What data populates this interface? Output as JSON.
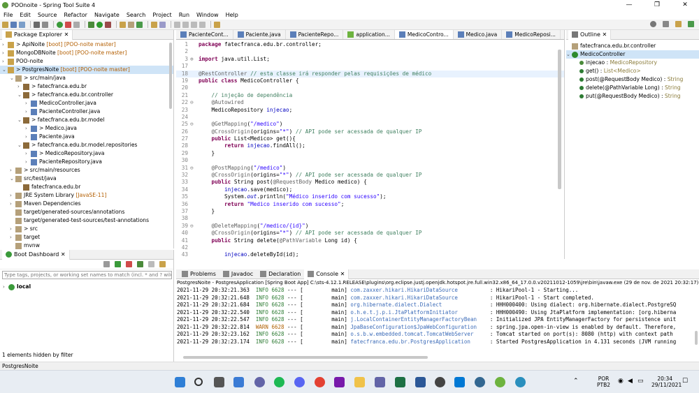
{
  "window": {
    "title": "POOnoite - Spring Tool Suite 4",
    "min": "—",
    "max": "❐",
    "close": "✕"
  },
  "menu": [
    "File",
    "Edit",
    "Source",
    "Refactor",
    "Navigate",
    "Search",
    "Project",
    "Run",
    "Window",
    "Help"
  ],
  "package_explorer": {
    "title": "Package Explorer",
    "close": "✕",
    "items": [
      {
        "text": "ApiNoite",
        "dec": " [boot] [POO-noite master]",
        "indent": 0,
        "arrow": "›",
        "pre": "> "
      },
      {
        "text": "MongoDBNoite",
        "dec": " [boot] [POO-noite master]",
        "indent": 0,
        "arrow": "›",
        "pre": ""
      },
      {
        "text": "POO-noite",
        "dec": "",
        "indent": 0,
        "arrow": "›",
        "pre": ""
      },
      {
        "text": "PostgresNoite",
        "dec": " [boot] [POO-noite master]",
        "indent": 0,
        "arrow": "⌄",
        "pre": "> ",
        "sel": true
      },
      {
        "text": "src/main/java",
        "dec": "",
        "indent": 1,
        "arrow": "⌄",
        "pre": "> "
      },
      {
        "text": "fatecfranca.edu.br",
        "dec": "",
        "indent": 2,
        "arrow": "›",
        "pre": "> "
      },
      {
        "text": "fatecfranca.edu.br.controller",
        "dec": "",
        "indent": 2,
        "arrow": "⌄",
        "pre": "> "
      },
      {
        "text": "MedicoController.java",
        "dec": "",
        "indent": 3,
        "arrow": "›",
        "pre": ""
      },
      {
        "text": "PacienteController.java",
        "dec": "",
        "indent": 3,
        "arrow": "›",
        "pre": ""
      },
      {
        "text": "fatecfranca.edu.br.model",
        "dec": "",
        "indent": 2,
        "arrow": "⌄",
        "pre": "> "
      },
      {
        "text": "Medico.java",
        "dec": "",
        "indent": 3,
        "arrow": "›",
        "pre": "> "
      },
      {
        "text": "Paciente.java",
        "dec": "",
        "indent": 3,
        "arrow": "›",
        "pre": ""
      },
      {
        "text": "fatecfranca.edu.br.model.repositories",
        "dec": "",
        "indent": 2,
        "arrow": "⌄",
        "pre": "> "
      },
      {
        "text": "MedicoRepository.java",
        "dec": "",
        "indent": 3,
        "arrow": "›",
        "pre": "> "
      },
      {
        "text": "PacienteRepository.java",
        "dec": "",
        "indent": 3,
        "arrow": "›",
        "pre": ""
      },
      {
        "text": "src/main/resources",
        "dec": "",
        "indent": 1,
        "arrow": "›",
        "pre": "> "
      },
      {
        "text": "src/test/java",
        "dec": "",
        "indent": 1,
        "arrow": "⌄",
        "pre": ""
      },
      {
        "text": "fatecfranca.edu.br",
        "dec": "",
        "indent": 2,
        "arrow": "",
        "pre": ""
      },
      {
        "text": "JRE System Library",
        "dec": " [JavaSE-11]",
        "indent": 1,
        "arrow": "›",
        "pre": ""
      },
      {
        "text": "Maven Dependencies",
        "dec": "",
        "indent": 1,
        "arrow": "›",
        "pre": ""
      },
      {
        "text": "target/generated-sources/annotations",
        "dec": "",
        "indent": 1,
        "arrow": "",
        "pre": ""
      },
      {
        "text": "target/generated-test-sources/test-annotations",
        "dec": "",
        "indent": 1,
        "arrow": "",
        "pre": ""
      },
      {
        "text": "src",
        "dec": "",
        "indent": 1,
        "arrow": "›",
        "pre": "> "
      },
      {
        "text": "target",
        "dec": "",
        "indent": 1,
        "arrow": "›",
        "pre": ""
      },
      {
        "text": "mvnw",
        "dec": "",
        "indent": 1,
        "arrow": "",
        "pre": ""
      }
    ]
  },
  "editor": {
    "tabs": [
      "PacienteCont...",
      "Paciente.java",
      "PacienteRepo...",
      "application...",
      "MedicoContro...",
      "Medico.java",
      "MedicoReposi..."
    ],
    "active_tab": 4,
    "lines": [
      {
        "n": "1",
        "html": "<span class='kw'>package</span> fatecfranca.edu.br.controller;"
      },
      {
        "n": "2",
        "html": ""
      },
      {
        "n": "3",
        "g": "⊕",
        "html": "<span class='kw'>import</span> java.util.List;"
      },
      {
        "n": "17",
        "html": ""
      },
      {
        "n": "18",
        "html": "<span class='ann'>@RestController</span> <span class='cm'>// esta classe irá responder pelas requisições de médico</span>",
        "hl": true
      },
      {
        "n": "19",
        "html": "<span class='kw'>public class</span> MedicoController {"
      },
      {
        "n": "20",
        "html": ""
      },
      {
        "n": "21",
        "html": "    <span class='cm'>// injeção de dependência</span>"
      },
      {
        "n": "22",
        "g": "⊖",
        "html": "    <span class='ann'>@Autowired</span>"
      },
      {
        "n": "23",
        "html": "    MedicoRepository <span class='fld'>injecao</span>;"
      },
      {
        "n": "24",
        "html": ""
      },
      {
        "n": "25",
        "g": "⊖",
        "html": "    <span class='ann'>@GetMapping</span>(<span class='str'>\"/medico\"</span>)"
      },
      {
        "n": "26",
        "html": "    <span class='ann'>@CrossOrigin</span>(origins=<span class='str'>\"*\"</span>) <span class='cm'>// API pode ser acessada de qualquer IP</span>"
      },
      {
        "n": "27",
        "html": "    <span class='kw'>public</span> List&lt;Medico&gt; get(){"
      },
      {
        "n": "28",
        "html": "        <span class='kw'>return</span> <span class='fld'>injecao</span>.findAll();"
      },
      {
        "n": "29",
        "html": "    }"
      },
      {
        "n": "30",
        "html": ""
      },
      {
        "n": "31",
        "g": "⊖",
        "html": "    <span class='ann'>@PostMapping</span>(<span class='str'>\"/medico\"</span>)"
      },
      {
        "n": "32",
        "html": "    <span class='ann'>@CrossOrigin</span>(origins=<span class='str'>\"*\"</span>) <span class='cm'>// API pode ser acessada de qualquer IP</span>"
      },
      {
        "n": "33",
        "html": "    <span class='kw'>public</span> String post(<span class='ann'>@RequestBody</span> Medico medico) {"
      },
      {
        "n": "34",
        "html": "        <span class='fld'>injecao</span>.save(medico);"
      },
      {
        "n": "35",
        "html": "        System.<span class='fld'><i>out</i></span>.println(<span class='str'>\"Médico inserido com sucesso\"</span>);"
      },
      {
        "n": "36",
        "html": "        <span class='kw'>return</span> <span class='str'>\"Medico inserido com sucesso\"</span>;"
      },
      {
        "n": "37",
        "html": "    }"
      },
      {
        "n": "38",
        "html": ""
      },
      {
        "n": "39",
        "g": "⊖",
        "html": "    <span class='ann'>@DeleteMapping</span>(<span class='str'>\"/medico/{id}\"</span>)"
      },
      {
        "n": "40",
        "html": "    <span class='ann'>@CrossOrigin</span>(origins=<span class='str'>\"*\"</span>) <span class='cm'>// API pode ser acessada de qualquer IP</span>"
      },
      {
        "n": "41",
        "html": "    <span class='kw'>public</span> String delete(<span class='ann'>@PathVariable</span> Long id) {"
      },
      {
        "n": "42",
        "html": ""
      },
      {
        "n": "43",
        "html": "        <span class='fld'>injecao</span>.deleteById(id);"
      }
    ]
  },
  "outline": {
    "title": "Outline",
    "close": "✕",
    "package": "fatecfranca.edu.br.controller",
    "class": "MedicoController",
    "members": [
      {
        "name": "injecao : ",
        "type": "MedicoRepository",
        "color": "#4a8a3a"
      },
      {
        "name": "get() : ",
        "type": "List<Medico>",
        "color": "#2d7b33"
      },
      {
        "name": "post(@RequestBody Medico) : ",
        "type": "String",
        "color": "#2d7b33"
      },
      {
        "name": "delete(@PathVariable Long) : ",
        "type": "String",
        "color": "#2d7b33"
      },
      {
        "name": "put(@RequestBody Medico) : ",
        "type": "String",
        "color": "#2d7b33"
      }
    ]
  },
  "boot": {
    "title": "Boot Dashboard",
    "close": "✕",
    "filter_placeholder": "Type tags, projects, or working set names to match (incl. * and ? wildc",
    "local": "local",
    "hidden": "1 elements hidden by filter"
  },
  "console": {
    "tabs": [
      "Problems",
      "Javadoc",
      "Declaration",
      "Console"
    ],
    "header": "PostgresNoite - PostgresApplication [Spring Boot App] C:\\sts-4.12.1.RELEASE\\plugins\\org.eclipse.justj.openjdk.hotspot.jre.full.win32.x86_64_17.0.0.v20211012-1059\\jre\\bin\\javaw.exe  (29 de nov. de 2021 20:32:17)",
    "lines": [
      {
        "ts": "2021-11-29 20:32:21.363",
        "lvl": "INFO",
        "pid": "6628",
        "th": "main",
        "lg": "com.zaxxer.hikari.HikariDataSource",
        "msg": ": HikariPool-1 - Starting..."
      },
      {
        "ts": "2021-11-29 20:32:21.648",
        "lvl": "INFO",
        "pid": "6628",
        "th": "main",
        "lg": "com.zaxxer.hikari.HikariDataSource",
        "msg": ": HikariPool-1 - Start completed."
      },
      {
        "ts": "2021-11-29 20:32:21.684",
        "lvl": "INFO",
        "pid": "6628",
        "th": "main",
        "lg": "org.hibernate.dialect.Dialect",
        "msg": ": HHH000400: Using dialect: org.hibernate.dialect.PostgreSQ"
      },
      {
        "ts": "2021-11-29 20:32:22.540",
        "lvl": "INFO",
        "pid": "6628",
        "th": "main",
        "lg": "o.h.e.t.j.p.i.JtaPlatformInitiator",
        "msg": ": HHH000490: Using JtaPlatform implementation: [org.hiberna"
      },
      {
        "ts": "2021-11-29 20:32:22.547",
        "lvl": "INFO",
        "pid": "6628",
        "th": "main",
        "lg": "j.LocalContainerEntityManagerFactoryBean",
        "msg": ": Initialized JPA EntityManagerFactory for persistence unit"
      },
      {
        "ts": "2021-11-29 20:32:22.814",
        "lvl": "WARN",
        "pid": "6628",
        "th": "main",
        "lg": "JpaBaseConfiguration$JpaWebConfiguration",
        "msg": ": spring.jpa.open-in-view is enabled by default. Therefore,"
      },
      {
        "ts": "2021-11-29 20:32:23.162",
        "lvl": "INFO",
        "pid": "6628",
        "th": "main",
        "lg": "o.s.b.w.embedded.tomcat.TomcatWebServer",
        "msg": ": Tomcat started on port(s): 8080 (http) with context path"
      },
      {
        "ts": "2021-11-29 20:32:23.174",
        "lvl": "INFO",
        "pid": "6628",
        "th": "main",
        "lg": "fatecfranca.edu.br.PostgresApplication",
        "msg": ": Started PostgresApplication in 4.131 seconds (JVM running"
      }
    ]
  },
  "status": "PostgresNoite",
  "taskbar": {
    "lang1": "POR",
    "lang2": "PTB2",
    "time": "20:34",
    "date": "29/11/2021"
  }
}
